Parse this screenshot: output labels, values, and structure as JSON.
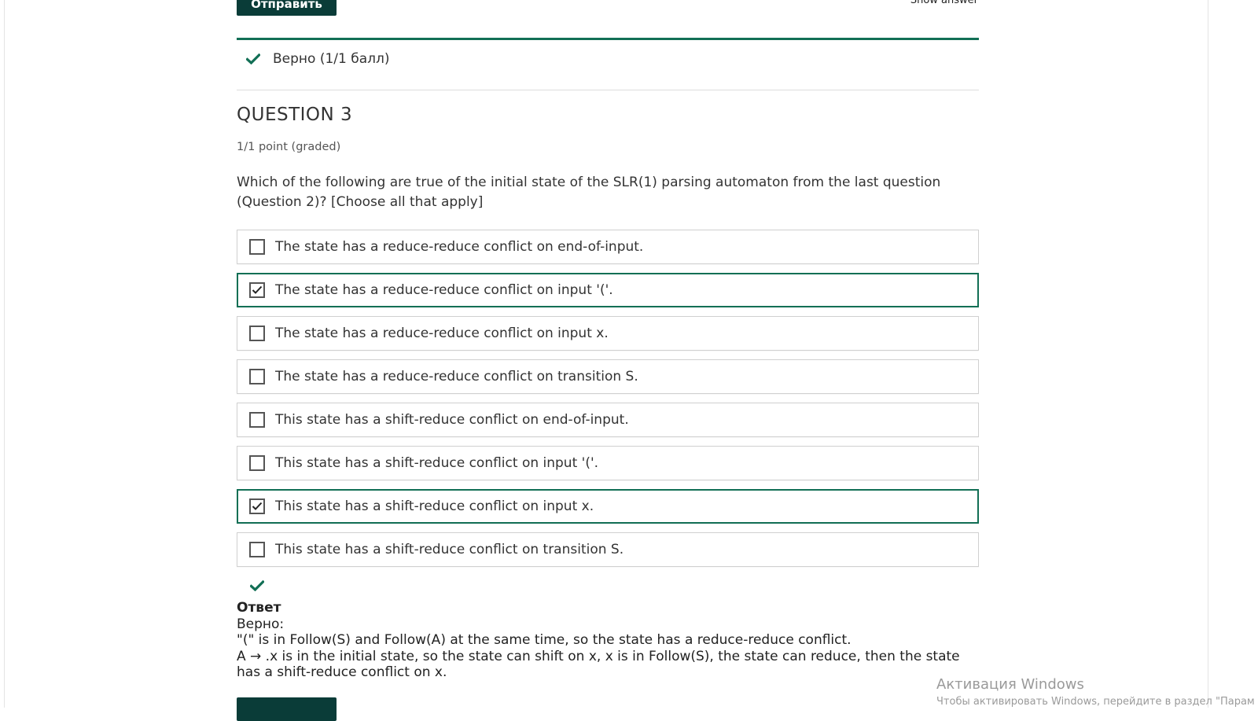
{
  "header": {
    "submit_label": "Отправить",
    "show_answer_label": "Show answer"
  },
  "previous_result": {
    "status_text": "Верно (1/1 балл)"
  },
  "question": {
    "title": "QUESTION 3",
    "points": "1/1 point (graded)",
    "text": "Which of the following are true of the initial state of the SLR(1) parsing automaton from the last question (Question 2)? [Choose all that apply]",
    "options": [
      {
        "label": "The state has a reduce-reduce conflict on end-of-input.",
        "checked": false
      },
      {
        "label": "The state has a reduce-reduce conflict on input '('.",
        "checked": true
      },
      {
        "label": "The state has a reduce-reduce conflict on input x.",
        "checked": false
      },
      {
        "label": "The state has a reduce-reduce conflict on transition S.",
        "checked": false
      },
      {
        "label": "This state has a shift-reduce conflict on end-of-input.",
        "checked": false
      },
      {
        "label": "This state has a shift-reduce conflict on input '('.",
        "checked": false
      },
      {
        "label": "This state has a shift-reduce conflict on input x.",
        "checked": true
      },
      {
        "label": "This state has a shift-reduce conflict on transition S.",
        "checked": false
      }
    ]
  },
  "answer": {
    "heading": "Ответ",
    "verdict": "Верно:",
    "line1": "\"(\" is in Follow(S) and Follow(A) at the same time, so the state has a reduce-reduce conflict.",
    "line2": "A → .x is in the initial state, so the state can shift on x, x is in Follow(S), the state can reduce, then the state has a shift-reduce conflict on x."
  },
  "watermark": {
    "title": "Активация Windows",
    "subtitle": "Чтобы активировать Windows, перейдите в раздел \"Парам"
  },
  "colors": {
    "accent_green": "#126f55",
    "button_dark": "#0a3c38"
  },
  "icons": {
    "status": "checkmark-icon",
    "checkbox_checked": "checkbox-checked-icon",
    "checkbox_unchecked": "checkbox-unchecked-icon"
  }
}
